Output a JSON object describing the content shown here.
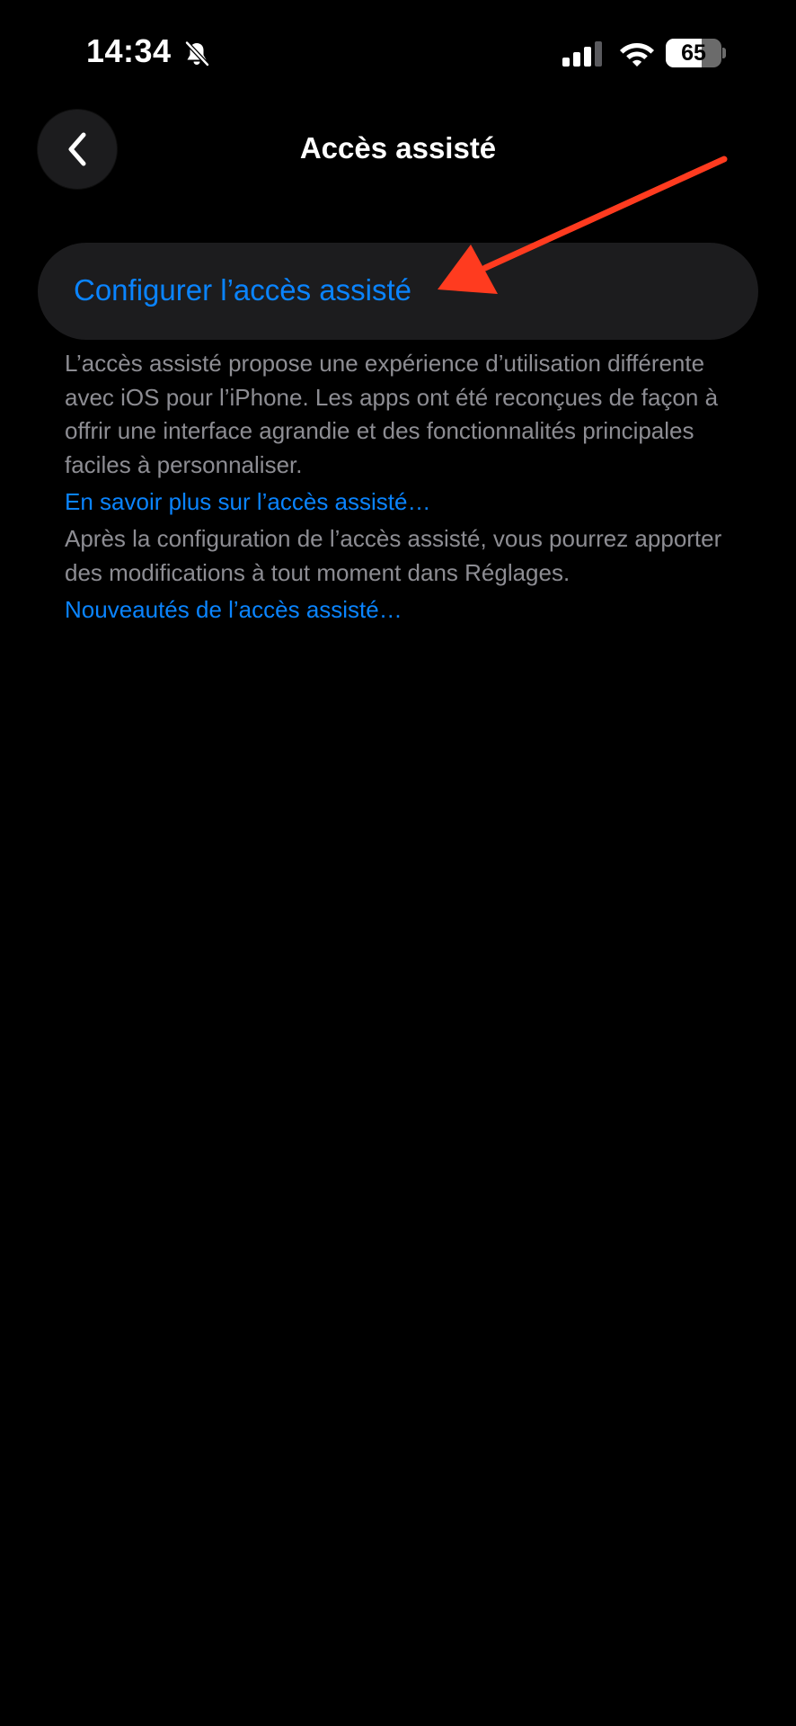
{
  "status_bar": {
    "time": "14:34",
    "battery_level": "65",
    "battery_fraction": 0.65,
    "icons": [
      "bell-off-icon",
      "signal-icon",
      "wifi-icon",
      "battery-icon"
    ]
  },
  "nav": {
    "back_icon": "chevron-left-icon",
    "title": "Accès assisté"
  },
  "setup": {
    "label": "Configurer l’accès assisté"
  },
  "footer": {
    "description": "L’accès assisté propose une expérience d’utilisation différente avec iOS pour l’iPhone. Les apps ont été reconçues de façon à offrir une interface agrandie et des fonctionnalités principales faciles à personnaliser.",
    "learn_more_link": "En savoir plus sur l’accès assisté…",
    "settings_note": "Après la configuration de l’accès assisté, vous pourrez apporter des modifications à tout moment dans Réglages.",
    "whats_new_link": "Nouveautés de l’accès assisté…"
  },
  "colors": {
    "background": "#000000",
    "card": "#1c1c1e",
    "accent": "#0a84ff",
    "secondary_text": "#8d8d93",
    "annotation": "#ff3b1f"
  }
}
